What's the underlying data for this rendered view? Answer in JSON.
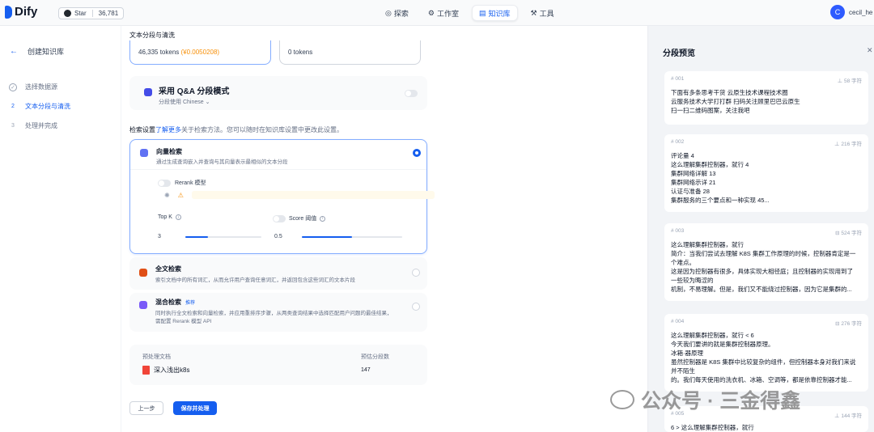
{
  "app": {
    "name": "Dify"
  },
  "github": {
    "label": "Star",
    "count": "36,781"
  },
  "nav": [
    {
      "label": "探索",
      "icon": "compass-icon"
    },
    {
      "label": "工作室",
      "icon": "studio-icon"
    },
    {
      "label": "知识库",
      "icon": "knowledge-icon"
    },
    {
      "label": "工具",
      "icon": "tools-icon"
    }
  ],
  "user": {
    "initial": "C",
    "name": "cecil_he"
  },
  "steps": {
    "back_label": "创建知识库",
    "items": [
      {
        "num": "✓",
        "label": "选择数据源"
      },
      {
        "num": "2",
        "label": "文本分段与清洗"
      },
      {
        "num": "3",
        "label": "处理并完成"
      }
    ]
  },
  "main": {
    "header": "文本分段与清洗",
    "estimate_primary": {
      "tokens": "46,335 tokens",
      "price": "(¥0.0050208)"
    },
    "estimate_secondary": {
      "tokens": "0 tokens"
    },
    "qa": {
      "title": "采用 Q&A 分段模式",
      "subtitle": "分段使用 Chinese ⌄"
    },
    "retrieval": {
      "prefix": "检索设置",
      "link": "了解更多",
      "suffix": "关于检索方法。您可以随时在知识库设置中更改此设置。"
    },
    "options": {
      "vector": {
        "title": "向量检索",
        "desc": "通过生成查询嵌入并查询与其向量表示最相似的文本分段"
      },
      "fulltext": {
        "title": "全文检索",
        "desc": "索引文档中的所有词汇，从而允许用户查询任意词汇，并返回包含这些词汇的文本片段"
      },
      "hybrid": {
        "title": "混合检索",
        "badge": "推荐",
        "desc": "同时执行全文检索和向量检索，并应用重排序步骤，从两类查询结果中选择匹配用户问题的最佳结果，",
        "desc2": "需配置 Rerank 模型 API"
      }
    },
    "rerank_label": "Rerank 模型",
    "topk": {
      "label": "Top K",
      "value": "3",
      "fraction": 0.3
    },
    "score": {
      "label": "Score 阈值",
      "value": "0.5",
      "fraction": 0.5
    },
    "docs": {
      "col1": "预处理文档",
      "col2": "预估分段数",
      "file": "深入浅出k8s",
      "count": "147"
    },
    "buttons": {
      "prev": "上一步",
      "save": "保存并处理"
    }
  },
  "preview": {
    "title": "分段预览",
    "segments": [
      {
        "id": "# 001",
        "chars": "⊥ 58 字符",
        "lines": [
          "下面有多条思考干货 云原生技术课程技术圈",
          "云服务技术大学打打群 扫码关注顾里巴巴云原生",
          "扫一扫二维码图案，关注我吧"
        ]
      },
      {
        "id": "# 002",
        "chars": "⊥ 216 字符",
        "lines": [
          "评论量 4",
          "这么理解集群控制器，就行      4",
          "集群网络详解 13",
          "集群网络示详 21",
          "认证与准备 28",
          "集群服务的三个要点和一种实现 45..."
        ]
      },
      {
        "id": "# 003",
        "chars": "⊟ 524 字符",
        "lines": [
          "这么理解集群控制器，就行",
          "简介：当我们尝试去理解 K8S 集群工作原理的时候，控制器肯定是一",
          "个难点。",
          "这是因为控制器有很多，具体实现大相径庭；且控制器的实现用到了",
          "一些较为晦涩的",
          "机制，不易理解。但是，我们又不能绕过控制器，因为它是集群的..."
        ]
      },
      {
        "id": "# 004",
        "chars": "⊟ 276 字符",
        "lines": [
          "这么理解集群控制器，就行       < 6",
          "今天我们要讲的就是集群控制器原理。",
          "冰箱·器原理",
          "虽然控制器是 K8S 集群中比较复杂的组件，但控制器本身对我们来说",
          "并不陌生",
          "的。我们每天使用的洗衣机、冰箱、空调等，都是依靠控制器才能..."
        ]
      },
      {
        "id": "# 005",
        "chars": "⊥ 144 字符",
        "lines": [
          "6 >    这么理解集群控制器，就行"
        ]
      }
    ]
  },
  "watermark": {
    "text": "公众号 · 三金得鑫"
  }
}
